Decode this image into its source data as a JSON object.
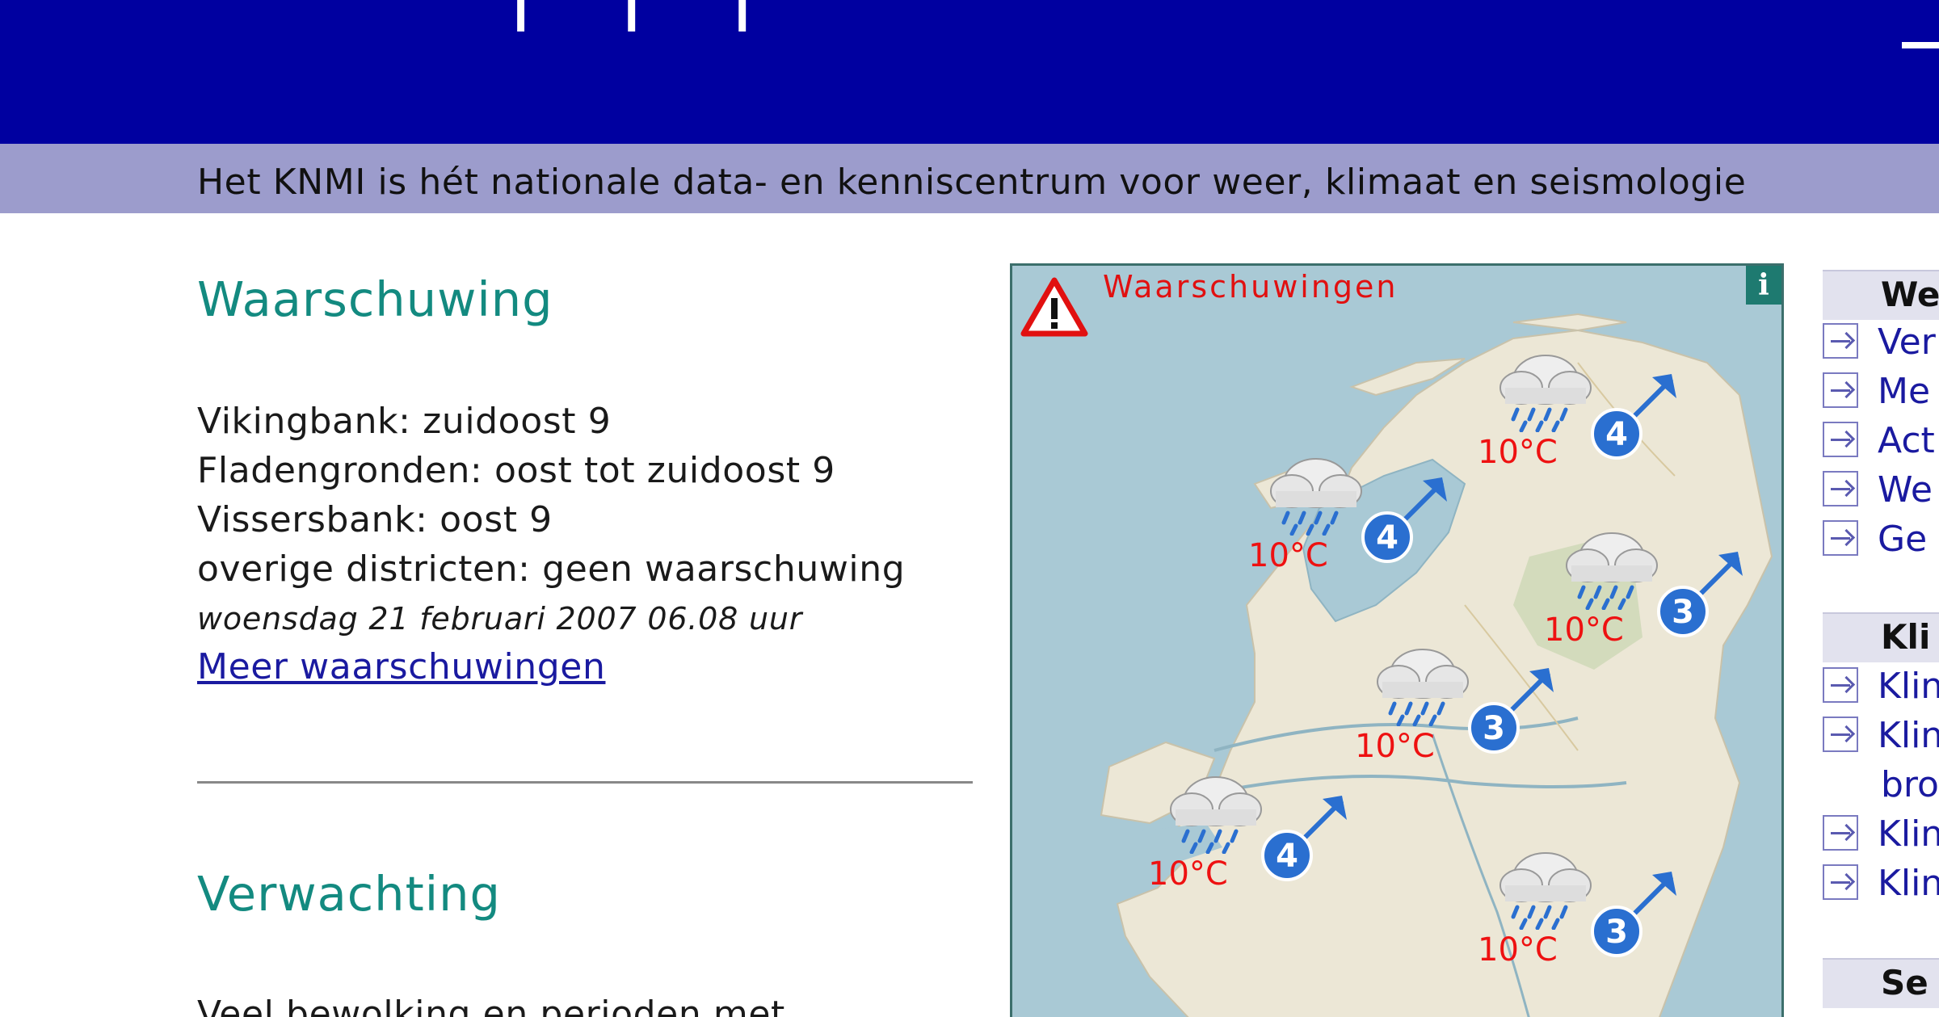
{
  "header": {
    "bg_color": "#0000a0",
    "title_fragment": "| | |"
  },
  "tagline": "Het KNMI is hét nationale data- en kenniscentrum voor weer, klimaat en seismologie",
  "warning_section": {
    "title": "Waarschuwing",
    "lines": [
      "Vikingbank: zuidoost 9",
      "Fladengronden: oost tot zuidoost 9",
      "Vissersbank: oost 9",
      "overige districten: geen waarschuwing"
    ],
    "date": "woensdag 21 februari 2007 06.08 uur",
    "more_link": "Meer waarschuwingen"
  },
  "forecast_section": {
    "title": "Verwachting",
    "text_fragment": "Veel bewolking en perioden met"
  },
  "map": {
    "title": "Waarschuwingen",
    "info_label": "i",
    "locations": [
      {
        "temp": "10°C",
        "wind_force": "4",
        "icon": "rain-cloud-icon"
      },
      {
        "temp": "10°C",
        "wind_force": "4",
        "icon": "rain-cloud-icon"
      },
      {
        "temp": "10°C",
        "wind_force": "3",
        "icon": "rain-cloud-icon"
      },
      {
        "temp": "10°C",
        "wind_force": "3",
        "icon": "rain-cloud-icon"
      },
      {
        "temp": "10°C",
        "wind_force": "4",
        "icon": "rain-cloud-icon"
      },
      {
        "temp": "10°C",
        "wind_force": "3",
        "icon": "rain-cloud-icon"
      }
    ]
  },
  "sidebar": {
    "groups": [
      {
        "heading": "We",
        "items": [
          "Ver",
          "Me",
          "Act",
          "We",
          "Ge"
        ]
      },
      {
        "heading": "Kli",
        "items": [
          "Klin",
          "Klin",
          "bro",
          "Klin",
          "Klin"
        ]
      },
      {
        "heading": "Se",
        "items": []
      }
    ]
  }
}
